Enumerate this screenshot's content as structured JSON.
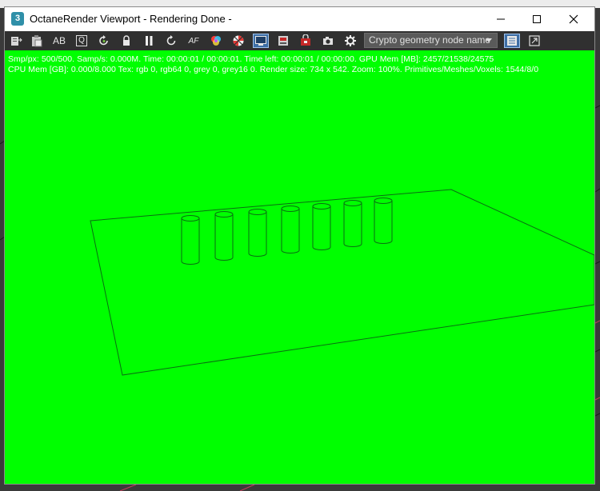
{
  "window": {
    "icon_label": "3",
    "title": "OctaneRender Viewport - Rendering Done -"
  },
  "toolbar": {
    "buttons": [
      {
        "name": "export-icon"
      },
      {
        "name": "clipboard-icon"
      },
      {
        "name": "ab-compare-icon",
        "label": "AB"
      },
      {
        "name": "quick-render-icon",
        "label": "Q"
      },
      {
        "name": "restart-render-icon"
      },
      {
        "name": "lock-icon"
      },
      {
        "name": "pause-icon"
      },
      {
        "name": "recompile-icon"
      },
      {
        "name": "autofocus-icon",
        "label": "AF"
      },
      {
        "name": "color-picker-icon"
      },
      {
        "name": "material-picker-icon"
      },
      {
        "name": "region-render-icon"
      },
      {
        "name": "film-region-icon"
      },
      {
        "name": "viewport-lock-icon"
      },
      {
        "name": "camera-icon"
      },
      {
        "name": "settings-icon"
      }
    ],
    "crypto_select": "Crypto geometry node name",
    "accent_color": "#3e6ea5"
  },
  "render": {
    "background_color": "#00ff00",
    "stats_line1": "Smp/px: 500/500.    Samp/s: 0.000M.    Time: 00:00:01 / 00:00:01.    Time left: 00:00:01 / 00:00:00.    GPU Mem [MB]: 2457/21538/24575",
    "stats_line2": "CPU Mem [GB]: 0.000/8.000    Tex: rgb 0, rgb64 0, grey 0, grey16 0.    Render size: 734 x 542.    Zoom: 100%.    Primitives/Meshes/Voxels: 1544/8/0"
  }
}
